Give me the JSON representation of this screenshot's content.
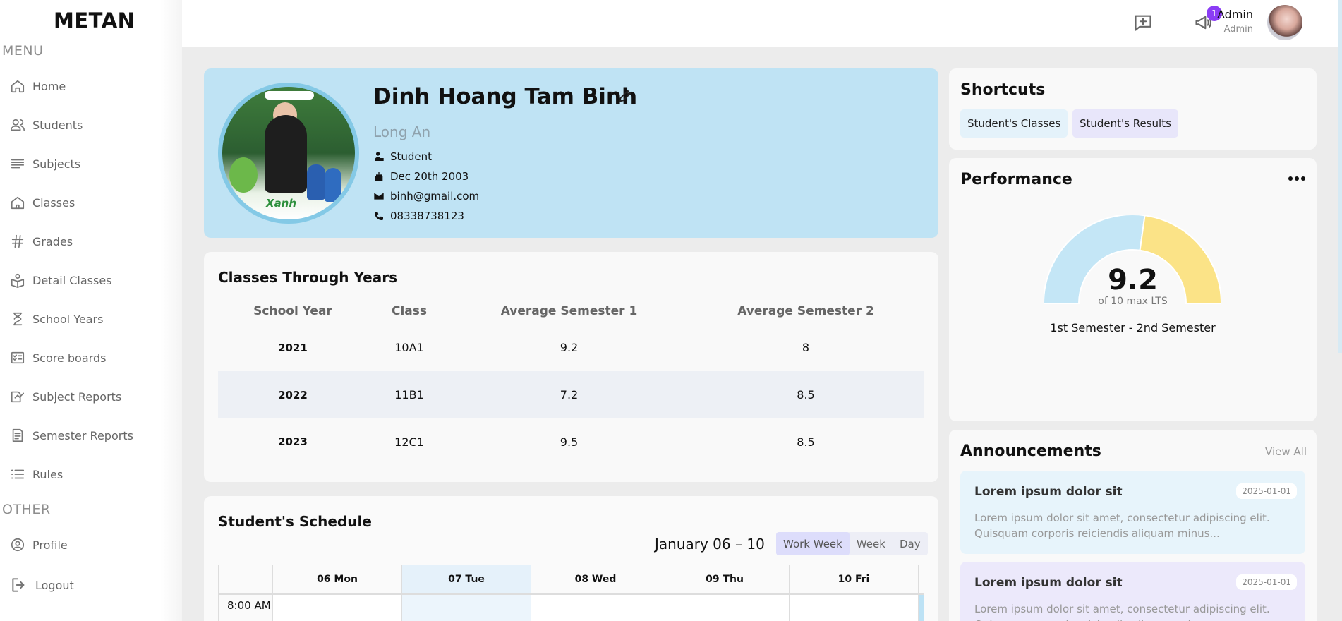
{
  "sidebar": {
    "logo": "METAN",
    "menu_label": "MENU",
    "other_label": "OTHER",
    "menu_items": [
      {
        "label": "Home",
        "icon": "home-icon"
      },
      {
        "label": "Students",
        "icon": "users-icon"
      },
      {
        "label": "Subjects",
        "icon": "lines-icon"
      },
      {
        "label": "Classes",
        "icon": "house-icon"
      },
      {
        "label": "Grades",
        "icon": "hash-icon"
      },
      {
        "label": "Detail Classes",
        "icon": "book-user-icon"
      },
      {
        "label": "School Years",
        "icon": "hourglass-icon"
      },
      {
        "label": "Score boards",
        "icon": "checklist-icon"
      },
      {
        "label": "Subject Reports",
        "icon": "report-icon"
      },
      {
        "label": "Semester Reports",
        "icon": "document-icon"
      },
      {
        "label": "Rules",
        "icon": "list-icon"
      }
    ],
    "other_items": [
      {
        "label": "Profile",
        "icon": "user-circle-icon"
      },
      {
        "label": "Logout",
        "icon": "logout-icon"
      }
    ]
  },
  "topbar": {
    "notification_count": "1",
    "user_name": "Admin",
    "user_role": "Admin"
  },
  "profile": {
    "name": "Dinh Hoang Tam Binh",
    "location": "Long An",
    "role": "Student",
    "birthday": "Dec 20th 2003",
    "email": "binh@gmail.com",
    "phone": "08338738123",
    "photo_brand": "Xanh"
  },
  "classes": {
    "title": "Classes Through Years",
    "headers": [
      "School Year",
      "Class",
      "Average Semester 1",
      "Average Semester 2"
    ],
    "rows": [
      [
        "2021",
        "10A1",
        "9.2",
        "8"
      ],
      [
        "2022",
        "11B1",
        "7.2",
        "8.5"
      ],
      [
        "2023",
        "12C1",
        "9.5",
        "8.5"
      ]
    ]
  },
  "schedule": {
    "title": "Student's Schedule",
    "date_range": "January 06 – 10",
    "views": [
      "Work Week",
      "Week",
      "Day"
    ],
    "active_view": "Work Week",
    "days": [
      "06 Mon",
      "07 Tue",
      "08 Wed",
      "09 Thu",
      "10 Fri"
    ],
    "highlighted_day": "07 Tue",
    "first_time": "8:00 AM"
  },
  "shortcuts": {
    "title": "Shortcuts",
    "items": [
      "Student's Classes",
      "Student's Results"
    ]
  },
  "performance": {
    "title": "Performance",
    "value": "9.2",
    "subtitle": "of 10 max LTS",
    "caption": "1st Semester - 2nd Semester",
    "colors": {
      "semester1": "#c4e6f6",
      "semester2": "#fbe387"
    }
  },
  "announcements": {
    "title": "Announcements",
    "view_all": "View All",
    "items": [
      {
        "title": "Lorem ipsum dolor sit",
        "date": "2025-01-01",
        "body": "Lorem ipsum dolor sit amet, consectetur adipiscing elit. Quisquam corporis reiciendis aliquam minus...",
        "color": "#e7f4fb"
      },
      {
        "title": "Lorem ipsum dolor sit",
        "date": "2025-01-01",
        "body": "Lorem ipsum dolor sit amet, consectetur adipiscing elit. Quisquam corporis reiciendis aliquam minus...",
        "color": "#ece9fb"
      }
    ]
  }
}
